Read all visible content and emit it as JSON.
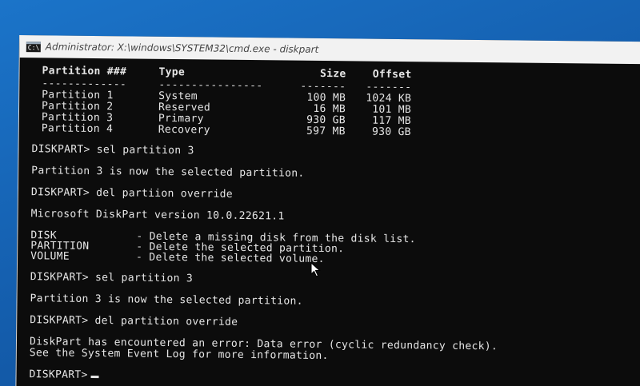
{
  "window": {
    "title": "Administrator: X:\\windows\\SYSTEM32\\cmd.exe - diskpart",
    "icon": "cmd-icon"
  },
  "table": {
    "headers": [
      "Partition ###",
      "Type",
      "Size",
      "Offset"
    ],
    "dividers": [
      "-------------",
      "----------------",
      "-------",
      "-------"
    ],
    "rows": [
      [
        "Partition 1",
        "System",
        "100 MB",
        "1024 KB"
      ],
      [
        "Partition 2",
        "Reserved",
        "16 MB",
        "101 MB"
      ],
      [
        "Partition 3",
        "Primary",
        "930 GB",
        "117 MB"
      ],
      [
        "Partition 4",
        "Recovery",
        "597 MB",
        "930 GB"
      ]
    ]
  },
  "lines": {
    "cmd1": "DISKPART> sel partition 3",
    "out1": "Partition 3 is now the selected partition.",
    "cmd2": "DISKPART> del partiion override",
    "out2": "Microsoft DiskPart version 10.0.22621.1",
    "options": [
      {
        "key": "DISK",
        "desc": "- Delete a missing disk from the disk list."
      },
      {
        "key": "PARTITION",
        "desc": "- Delete the selected partition."
      },
      {
        "key": "VOLUME",
        "desc": "- Delete the selected volume."
      }
    ],
    "cmd3": "DISKPART> sel partition 3",
    "out3": "Partition 3 is now the selected partition.",
    "cmd4": "DISKPART> del partition override",
    "err1": "DiskPart has encountered an error: Data error (cyclic redundancy check).",
    "err2": "See the System Event Log for more information.",
    "prompt": "DISKPART>"
  },
  "colors": {
    "console_bg": "#0c0c0c",
    "console_fg": "#e6e6e6",
    "desktop": "#1560b0"
  }
}
